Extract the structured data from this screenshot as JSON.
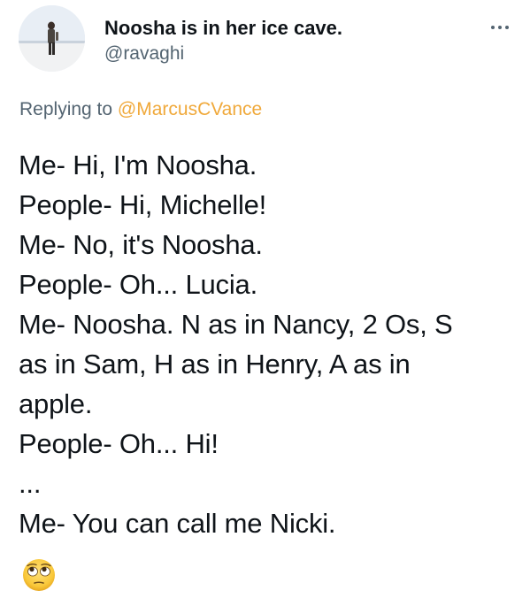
{
  "author": {
    "display_name": "Noosha is in her ice cave.",
    "handle": "@ravaghi"
  },
  "reply": {
    "prefix": "Replying to ",
    "mention": "@MarcusCVance"
  },
  "tweet": {
    "lines": [
      "Me- Hi, I'm Noosha.",
      "People- Hi, Michelle!",
      "Me- No, it's Noosha.",
      "People- Oh... Lucia.",
      "Me- Noosha. N as in Nancy, 2 Os, S",
      "as in Sam, H as in Henry, A as in",
      "apple.",
      "People- Oh... Hi!",
      "...",
      "Me- You can call me Nicki."
    ],
    "emoji": "face-with-rolling-eyes"
  },
  "colors": {
    "text": "#0f1419",
    "secondary": "#536471",
    "mention": "#f0a93b"
  }
}
